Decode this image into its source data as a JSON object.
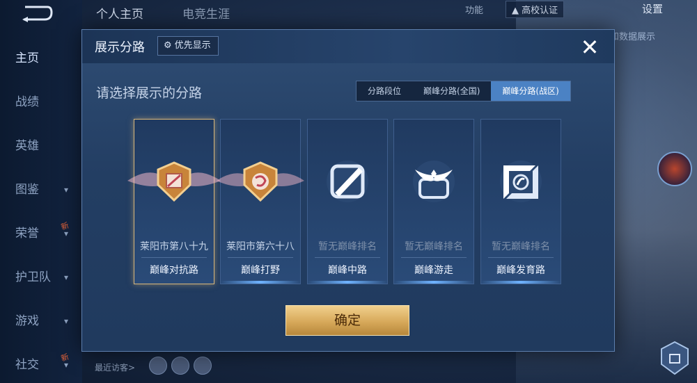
{
  "sidebar": {
    "items": [
      {
        "label": "主页",
        "active": true,
        "chevron": false,
        "badge": ""
      },
      {
        "label": "战绩",
        "active": false,
        "chevron": false,
        "badge": ""
      },
      {
        "label": "英雄",
        "active": false,
        "chevron": false,
        "badge": ""
      },
      {
        "label": "图鉴",
        "active": false,
        "chevron": true,
        "badge": ""
      },
      {
        "label": "荣誉",
        "active": false,
        "chevron": true,
        "badge": "新"
      },
      {
        "label": "护卫队",
        "active": false,
        "chevron": true,
        "badge": ""
      },
      {
        "label": "游戏",
        "active": false,
        "chevron": true,
        "badge": ""
      },
      {
        "label": "社交",
        "active": false,
        "chevron": true,
        "badge": "新"
      }
    ]
  },
  "topbar": {
    "tab_profile": "个人主页",
    "tab_esports": "电竞生涯",
    "link_function": "功能",
    "cert_label": "高校认证",
    "settings_label": "设置",
    "bg_text": "和数据展示"
  },
  "footer": {
    "recent_visitors": "最近访客>"
  },
  "modal": {
    "title": "展示分路",
    "priority_label": "优先显示",
    "close_label": "✕",
    "subtitle": "请选择展示的分路",
    "segments": [
      {
        "label": "分路段位",
        "active": false
      },
      {
        "label": "巅峰分路(全国)",
        "active": false
      },
      {
        "label": "巅峰分路(战区)",
        "active": true
      }
    ],
    "cards": [
      {
        "rank": "莱阳市第八十九",
        "name": "巅峰对抗路",
        "icon": "shield-sword-icon",
        "selected": true,
        "ranked": true
      },
      {
        "rank": "莱阳市第六十八",
        "name": "巅峰打野",
        "icon": "shield-claw-icon",
        "selected": false,
        "ranked": true
      },
      {
        "rank": "暂无巅峰排名",
        "name": "巅峰中路",
        "icon": "mid-lane-icon",
        "selected": false,
        "ranked": false
      },
      {
        "rank": "暂无巅峰排名",
        "name": "巅峰游走",
        "icon": "wings-icon",
        "selected": false,
        "ranked": false
      },
      {
        "rank": "暂无巅峰排名",
        "name": "巅峰发育路",
        "icon": "farm-lane-icon",
        "selected": false,
        "ranked": false
      }
    ],
    "confirm_label": "确定"
  },
  "colors": {
    "accent_gold": "#d7a95a",
    "segment_active": "#4b82c4",
    "modal_bg": "#233e63"
  }
}
